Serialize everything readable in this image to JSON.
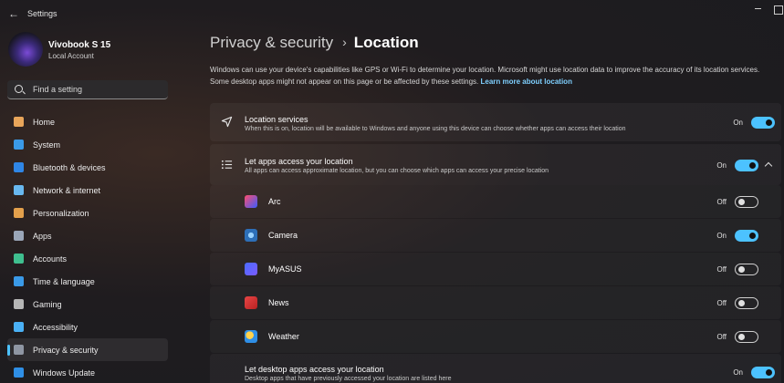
{
  "window": {
    "title": "Settings"
  },
  "profile": {
    "name": "Vivobook S 15",
    "account": "Local Account"
  },
  "search": {
    "placeholder": "Find a setting"
  },
  "sidebar": {
    "items": [
      {
        "label": "Home",
        "icon": "home-icon",
        "color": "#e8a55a"
      },
      {
        "label": "System",
        "icon": "system-icon",
        "color": "#3a9ae8"
      },
      {
        "label": "Bluetooth & devices",
        "icon": "bluetooth-icon",
        "color": "#2f86e6"
      },
      {
        "label": "Network & internet",
        "icon": "wifi-icon",
        "color": "#68b8f0"
      },
      {
        "label": "Personalization",
        "icon": "brush-icon",
        "color": "#e3a04c"
      },
      {
        "label": "Apps",
        "icon": "apps-icon",
        "color": "#9aa6b8"
      },
      {
        "label": "Accounts",
        "icon": "accounts-icon",
        "color": "#3fbf8f"
      },
      {
        "label": "Time & language",
        "icon": "time-language-icon",
        "color": "#3a9ae8"
      },
      {
        "label": "Gaming",
        "icon": "gaming-icon",
        "color": "#b6b6b6"
      },
      {
        "label": "Accessibility",
        "icon": "accessibility-icon",
        "color": "#4ab0f5"
      },
      {
        "label": "Privacy & security",
        "icon": "shield-icon",
        "color": "#8f96a3"
      },
      {
        "label": "Windows Update",
        "icon": "windows-update-icon",
        "color": "#2f8fe6"
      }
    ],
    "active_index": 10
  },
  "breadcrumb": {
    "parent": "Privacy & security",
    "separator": "›",
    "current": "Location"
  },
  "intro": {
    "text": "Windows can use your device's capabilities like GPS or Wi-Fi to determine your location. Microsoft might use location data to improve the accuracy of its location services. Some desktop apps might not appear on this page or be affected by these settings.",
    "link": "Learn more about location"
  },
  "location_services": {
    "title": "Location services",
    "description": "When this is on, location will be available to Windows and anyone using this device can choose whether apps can access their location",
    "state": "On"
  },
  "app_access": {
    "title": "Let apps access your location",
    "description": "All apps can access approximate location, but you can choose which apps can access your precise location",
    "state": "On"
  },
  "apps": [
    {
      "name": "Arc",
      "state": "Off",
      "icon": "arc-icon"
    },
    {
      "name": "Camera",
      "state": "On",
      "icon": "camera-icon"
    },
    {
      "name": "MyASUS",
      "state": "Off",
      "icon": "myasus-icon"
    },
    {
      "name": "News",
      "state": "Off",
      "icon": "news-icon"
    },
    {
      "name": "Weather",
      "state": "Off",
      "icon": "weather-icon"
    }
  ],
  "desktop_access": {
    "title": "Let desktop apps access your location",
    "description": "Desktop apps that have previously accessed your location are listed here",
    "state": "On"
  },
  "colors": {
    "accent": "#4cc2ff"
  }
}
